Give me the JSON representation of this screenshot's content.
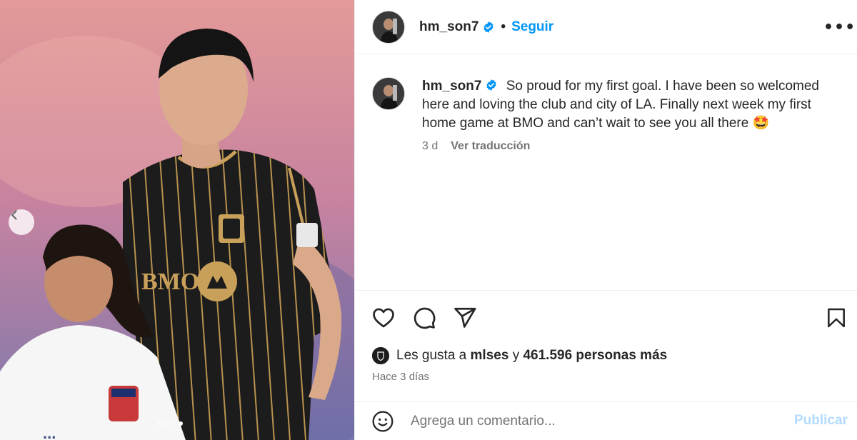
{
  "header": {
    "username": "hm_son7",
    "separator": "•",
    "follow_label": "Seguir",
    "more_label": "•••"
  },
  "caption": {
    "username": "hm_son7",
    "text": "So proud for my first goal. I have been so welcomed here and loving the club and city of LA. Finally next week my first home game at BMO and can’t wait to see you all there 🤩",
    "time": "3 d",
    "translate_label": "Ver traducción"
  },
  "photo": {
    "jersey_sponsor": "BMO",
    "carousel_total": 4,
    "carousel_active": 4
  },
  "likes": {
    "prefix": "Les gusta a",
    "first_user": "mlses",
    "connector": "y",
    "count_text": "461.596 personas más"
  },
  "posted_ago": "Hace 3 días",
  "comment": {
    "placeholder": "Agrega un comentario...",
    "publish_label": "Publicar"
  },
  "icons": {
    "verified": "verified-badge-icon",
    "like": "heart-icon",
    "comment": "comment-bubble-icon",
    "share": "paper-plane-icon",
    "save": "bookmark-icon",
    "emoji": "smiley-icon",
    "prev": "chevron-left-icon"
  },
  "colors": {
    "link_blue": "#0095f6",
    "publish_disabled": "#b3dbff",
    "muted_text": "#737373",
    "jersey_black": "#1c1c1c",
    "jersey_gold": "#c9a05a"
  }
}
